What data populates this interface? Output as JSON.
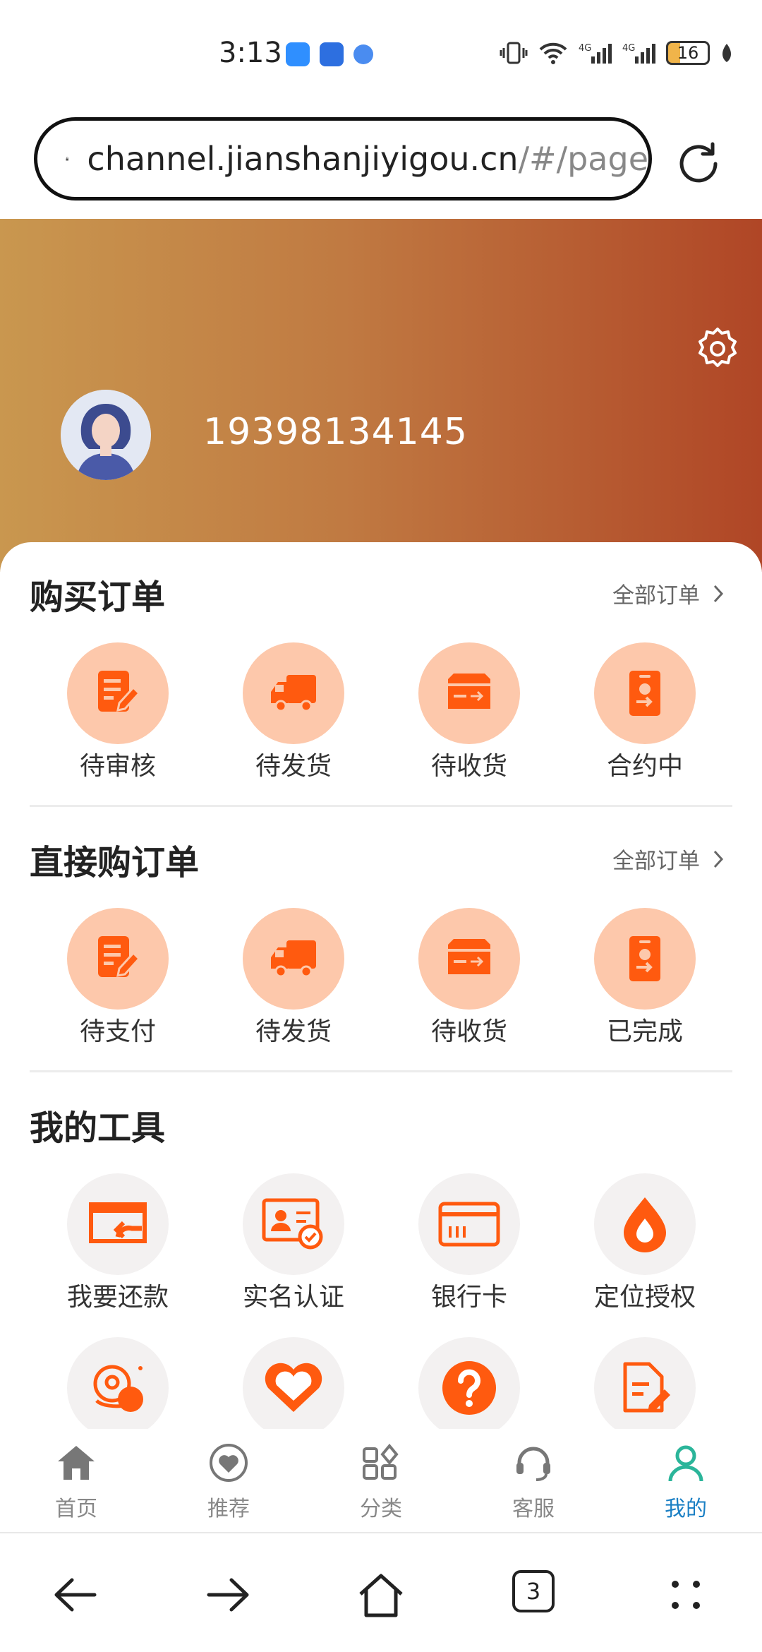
{
  "status_bar": {
    "time": "3:13",
    "battery": "16"
  },
  "browser": {
    "url_host": "channel.jianshanjiyigou.cn",
    "url_path": "/#/page",
    "tab_count": "3"
  },
  "profile": {
    "phone": "19398134145"
  },
  "sections": {
    "purchase_orders": {
      "title": "购买订单",
      "link": "全部订单",
      "items": [
        {
          "label": "待审核",
          "icon": "document-edit-icon"
        },
        {
          "label": "待发货",
          "icon": "truck-icon"
        },
        {
          "label": "待收货",
          "icon": "parcel-box-icon"
        },
        {
          "label": "合约中",
          "icon": "contract-badge-icon"
        }
      ]
    },
    "direct_orders": {
      "title": "直接购订单",
      "link": "全部订单",
      "items": [
        {
          "label": "待支付",
          "icon": "document-edit-icon"
        },
        {
          "label": "待发货",
          "icon": "truck-icon"
        },
        {
          "label": "待收货",
          "icon": "parcel-box-icon"
        },
        {
          "label": "已完成",
          "icon": "contract-badge-icon"
        }
      ]
    },
    "tools": {
      "title": "我的工具",
      "items": [
        {
          "label": "我要还款",
          "icon": "repay-icon"
        },
        {
          "label": "实名认证",
          "icon": "id-card-check-icon"
        },
        {
          "label": "银行卡",
          "icon": "bank-card-icon"
        },
        {
          "label": "定位授权",
          "icon": "location-drop-icon"
        },
        {
          "label": "",
          "icon": "location-pin-icon"
        },
        {
          "label": "",
          "icon": "heart-icon"
        },
        {
          "label": "",
          "icon": "help-icon"
        },
        {
          "label": "",
          "icon": "document-pen-icon"
        }
      ]
    }
  },
  "tab_bar": [
    {
      "label": "首页",
      "icon": "home-icon"
    },
    {
      "label": "推荐",
      "icon": "heart-circle-icon"
    },
    {
      "label": "分类",
      "icon": "category-icon"
    },
    {
      "label": "客服",
      "icon": "headset-icon"
    },
    {
      "label": "我的",
      "icon": "user-icon",
      "active": true
    }
  ],
  "colors": {
    "accent": "#ff5a0f",
    "peach": "#fdc8ab",
    "active_tab": "#1a7fc4",
    "header_start": "#c9974f",
    "header_end": "#b04626"
  }
}
